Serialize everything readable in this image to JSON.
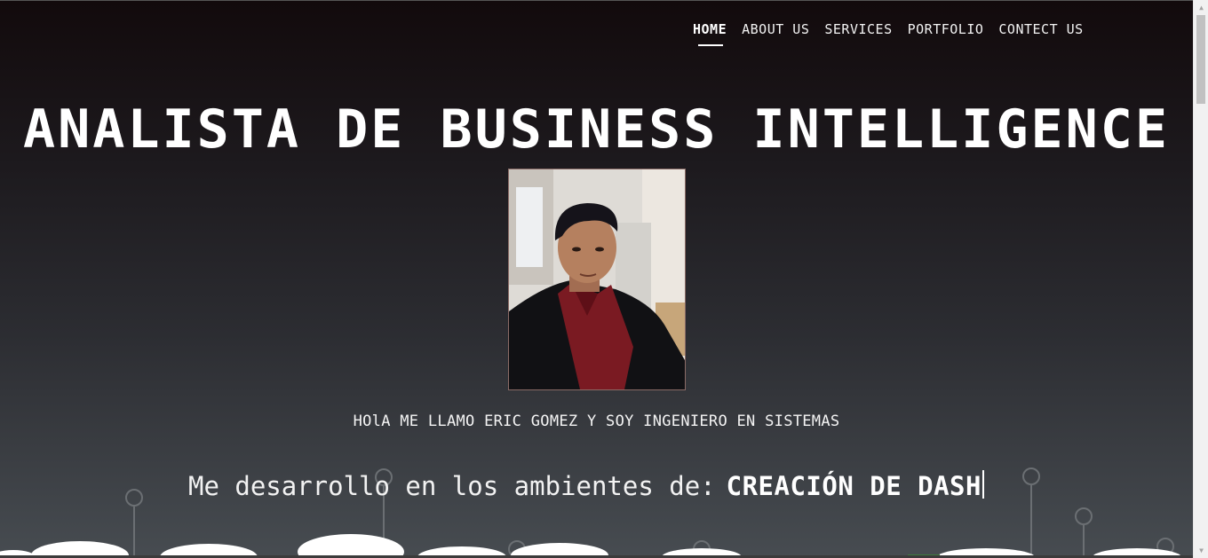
{
  "nav": {
    "items": [
      {
        "label": "HOME",
        "active": true
      },
      {
        "label": "ABOUT US",
        "active": false
      },
      {
        "label": "SERVICES",
        "active": false
      },
      {
        "label": "PORTFOLIO",
        "active": false
      },
      {
        "label": "CONTECT US",
        "active": false
      }
    ]
  },
  "hero": {
    "title": "ANALISTA DE BUSINESS INTELLIGENCE",
    "intro": "HOlA ME LLAMO ERIC GOMEZ Y SOY INGENIERO EN SISTEMAS",
    "tagline_prefix": "Me desarrollo en los ambientes de:",
    "tagline_typed": "CREACIÓN DE DASH"
  },
  "colors": {
    "bg_top": "#120a0c",
    "bg_bottom": "#474c51",
    "text": "#ffffff"
  },
  "icons": {
    "scroll_up": "chevron-up-icon",
    "scroll_down": "chevron-down-icon"
  }
}
